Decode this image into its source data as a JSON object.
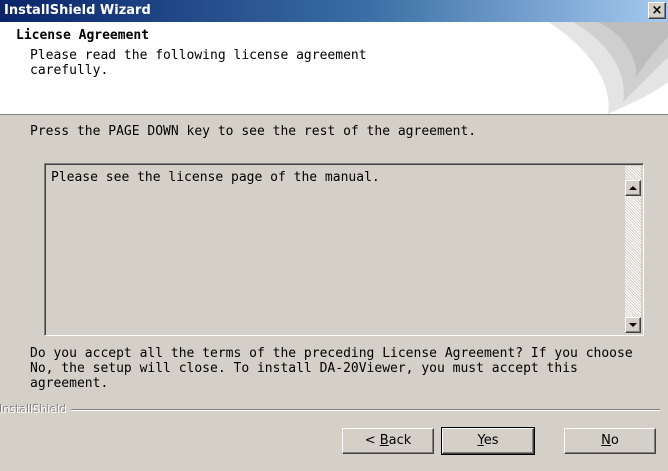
{
  "window": {
    "title": "InstallShield Wizard",
    "close_label": "×"
  },
  "header": {
    "title": "License Agreement",
    "subtitle": "Please read the following license agreement carefully."
  },
  "instruction": "Press the PAGE DOWN key to see the rest of the agreement.",
  "license": {
    "text": "Please see the license page of the manual."
  },
  "question": "Do you accept all the terms of the preceding License Agreement?  If you choose No,  the setup will close.  To install DA-20Viewer, you must accept this agreement.",
  "branding": {
    "label": "InstallShield"
  },
  "buttons": {
    "back": {
      "prefix": "< ",
      "mnemonic": "B",
      "rest": "ack"
    },
    "yes": {
      "mnemonic": "Y",
      "rest": "es"
    },
    "no": {
      "mnemonic": "N",
      "rest": "o"
    }
  },
  "colors": {
    "titlebar_start": "#0a246a",
    "titlebar_end": "#a6caf0",
    "face": "#d4d0c8"
  },
  "icons": [
    "close-icon",
    "scroll-up-arrow-icon",
    "scroll-down-arrow-icon",
    "header-swoosh-graphic"
  ]
}
